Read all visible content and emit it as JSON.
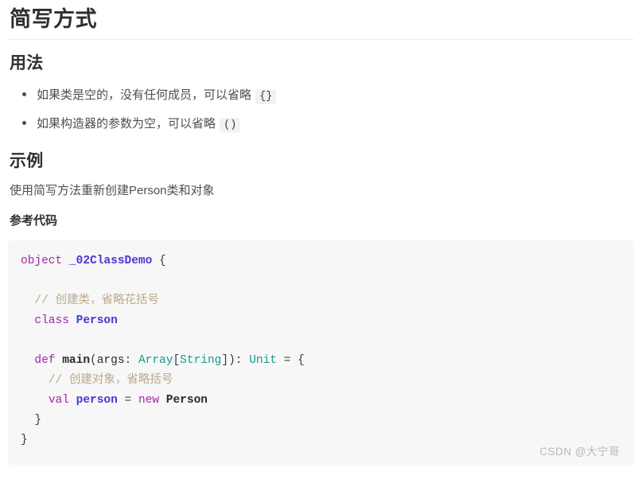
{
  "article": {
    "title": "简写方式",
    "sections": [
      {
        "heading": "用法",
        "bullets": [
          {
            "text_before": "如果类是空的，没有任何成员，可以省略 ",
            "code": "{}",
            "text_after": ""
          },
          {
            "text_before": "如果构造器的参数为空，可以省略 ",
            "code": "()",
            "text_after": ""
          }
        ]
      },
      {
        "heading": "示例",
        "paragraph": "使用简写方法重新创建Person类和对象",
        "code_label": "参考代码"
      }
    ]
  },
  "code_block": {
    "language": "scala",
    "lines": [
      [
        {
          "t": "object",
          "c": "kw"
        },
        {
          "t": " ",
          "c": "plain"
        },
        {
          "t": "_02ClassDemo",
          "c": "cls"
        },
        {
          "t": " ",
          "c": "plain"
        },
        {
          "t": "{",
          "c": "punc"
        }
      ],
      [],
      [
        {
          "t": "  ",
          "c": "plain"
        },
        {
          "t": "// 创建类，省略花括号",
          "c": "cmt"
        }
      ],
      [
        {
          "t": "  ",
          "c": "plain"
        },
        {
          "t": "class",
          "c": "kw"
        },
        {
          "t": " ",
          "c": "plain"
        },
        {
          "t": "Person",
          "c": "cls"
        }
      ],
      [],
      [
        {
          "t": "  ",
          "c": "plain"
        },
        {
          "t": "def",
          "c": "kw"
        },
        {
          "t": " ",
          "c": "plain"
        },
        {
          "t": "main",
          "c": "fn"
        },
        {
          "t": "(",
          "c": "punc"
        },
        {
          "t": "args",
          "c": "plain"
        },
        {
          "t": ": ",
          "c": "punc"
        },
        {
          "t": "Array",
          "c": "typ"
        },
        {
          "t": "[",
          "c": "punc"
        },
        {
          "t": "String",
          "c": "typ"
        },
        {
          "t": "])",
          "c": "punc"
        },
        {
          "t": ": ",
          "c": "punc"
        },
        {
          "t": "Unit",
          "c": "typ"
        },
        {
          "t": " ",
          "c": "plain"
        },
        {
          "t": "=",
          "c": "op"
        },
        {
          "t": " ",
          "c": "plain"
        },
        {
          "t": "{",
          "c": "punc"
        }
      ],
      [
        {
          "t": "    ",
          "c": "plain"
        },
        {
          "t": "// 创建对象，省略括号",
          "c": "cmt"
        }
      ],
      [
        {
          "t": "    ",
          "c": "plain"
        },
        {
          "t": "val",
          "c": "kw"
        },
        {
          "t": " ",
          "c": "plain"
        },
        {
          "t": "person",
          "c": "var"
        },
        {
          "t": " ",
          "c": "plain"
        },
        {
          "t": "=",
          "c": "op"
        },
        {
          "t": " ",
          "c": "plain"
        },
        {
          "t": "new",
          "c": "kw"
        },
        {
          "t": " ",
          "c": "plain"
        },
        {
          "t": "Person",
          "c": "id"
        }
      ],
      [
        {
          "t": "  ",
          "c": "plain"
        },
        {
          "t": "}",
          "c": "punc"
        }
      ],
      [
        {
          "t": "}",
          "c": "punc"
        }
      ]
    ]
  },
  "watermark": {
    "text": "CSDN @大宁哥"
  },
  "colors": {
    "keyword": "#a626a4",
    "type": "#1a9a8c",
    "class_name": "#4a36d6",
    "comment": "#bba98b",
    "code_bg": "#f7f7f8",
    "inline_code_bg": "#f2f2f3",
    "heading": "#2f2f2f",
    "body_text": "#4f4f4f",
    "watermark": "#b9b9bd"
  }
}
